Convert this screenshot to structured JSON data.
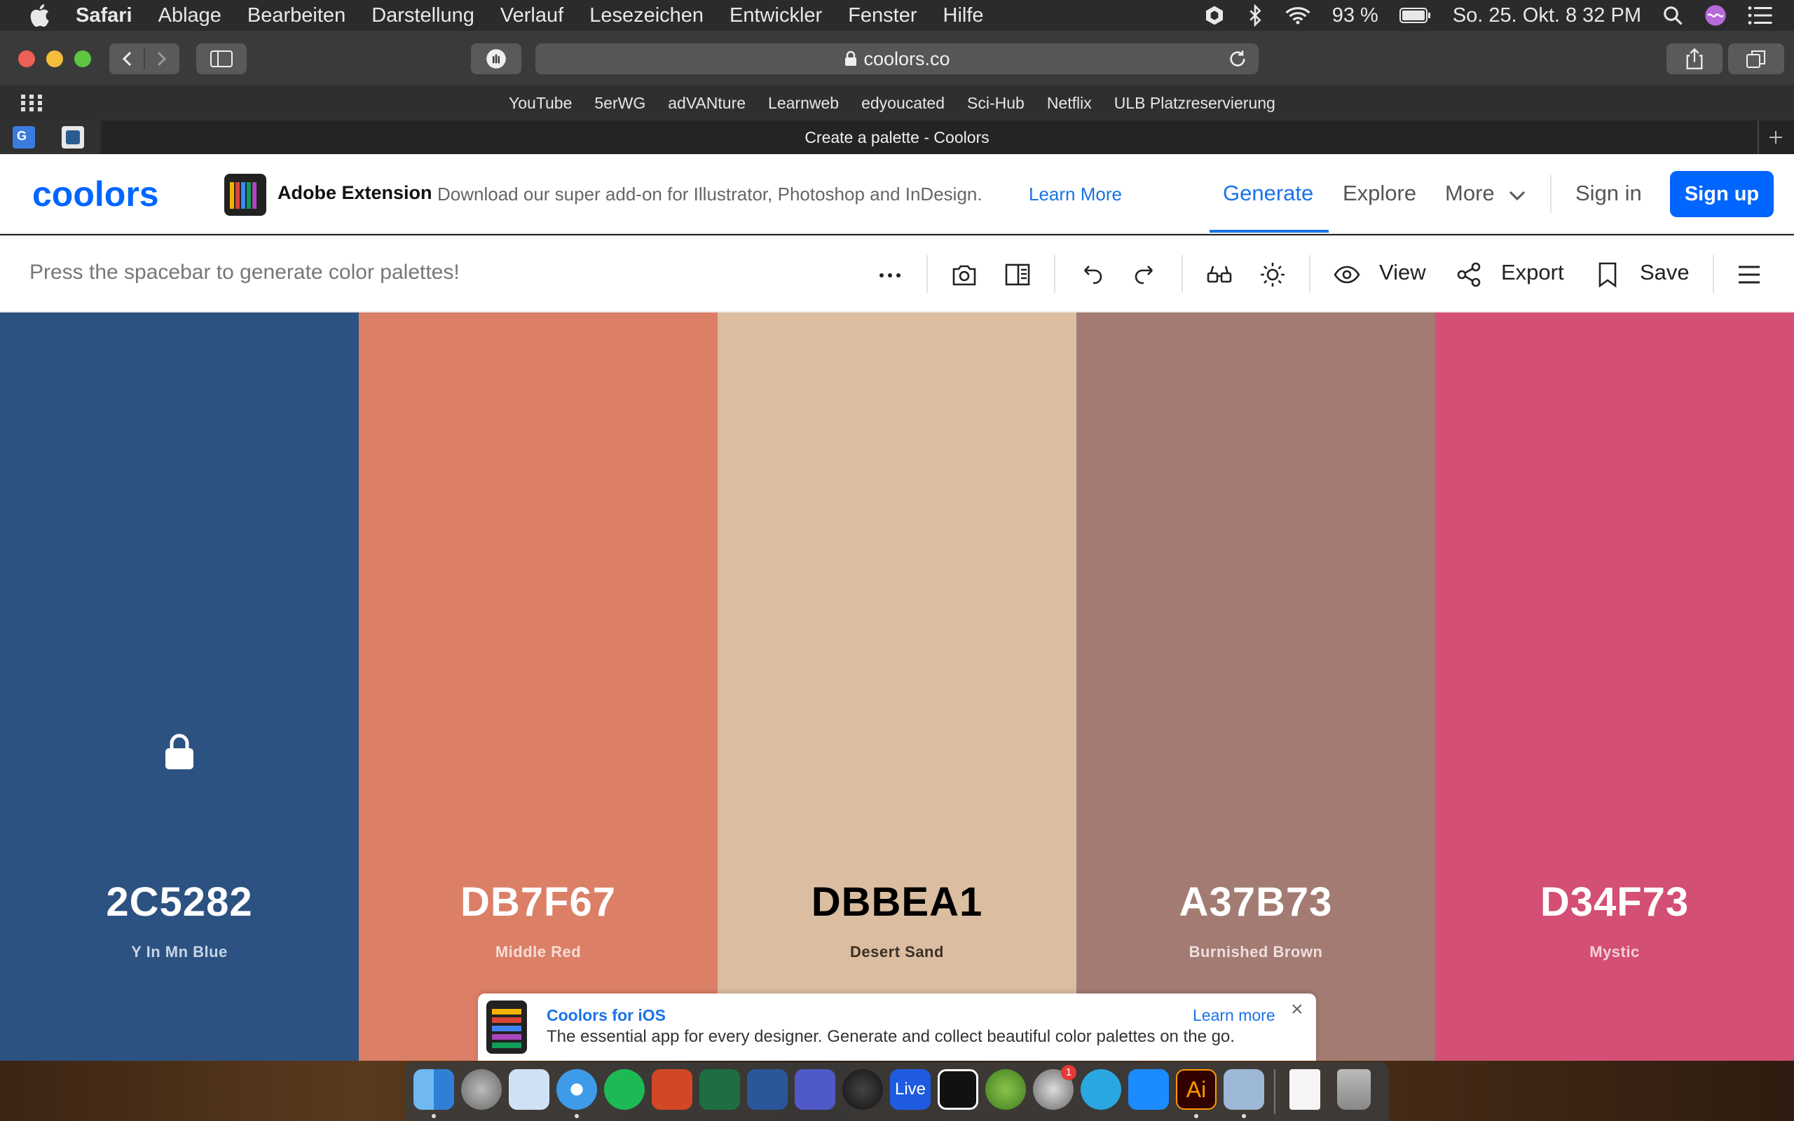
{
  "menubar": {
    "items": [
      "Safari",
      "Ablage",
      "Bearbeiten",
      "Darstellung",
      "Verlauf",
      "Lesezeichen",
      "Entwickler",
      "Fenster",
      "Hilfe"
    ],
    "battery": "93 %",
    "datetime": "So. 25. Okt.  8 32 PM"
  },
  "browser": {
    "url": "coolors.co",
    "bookmarks": [
      "YouTube",
      "5erWG",
      "adVANture",
      "Learnweb",
      "edyoucated",
      "Sci-Hub",
      "Netflix",
      "ULB Platzreservierung"
    ],
    "tab_title": "Create a palette - Coolors"
  },
  "header": {
    "logo": "coolors",
    "ext_title": "Adobe Extension",
    "ext_desc": "Download our super add-on for Illustrator, Photoshop and InDesign.",
    "ext_learn": "Learn More",
    "nav": {
      "generate": "Generate",
      "explore": "Explore",
      "more": "More"
    },
    "signin": "Sign in",
    "signup": "Sign up",
    "accent": "#0066ff"
  },
  "toolbar": {
    "hint": "Press the spacebar to generate color palettes!",
    "view": "View",
    "export": "Export",
    "save": "Save"
  },
  "palette": [
    {
      "hex": "2C5282",
      "name": "Y In Mn Blue",
      "color": "#2C5282",
      "text": "#ffffff",
      "sub": "#c8d4e6",
      "locked": true
    },
    {
      "hex": "DB7F67",
      "name": "Middle Red",
      "color": "#DB7F67",
      "text": "#ffffff",
      "sub": "#f6ddd6",
      "locked": false
    },
    {
      "hex": "DBBEA1",
      "name": "Desert Sand",
      "color": "#DBBEA1",
      "text": "#000000",
      "sub": "#3a3026",
      "locked": false
    },
    {
      "hex": "A37B73",
      "name": "Burnished Brown",
      "color": "#A37B73",
      "text": "#ffffff",
      "sub": "#eedfdc",
      "locked": false
    },
    {
      "hex": "D34F73",
      "name": "Mystic",
      "color": "#D34F73",
      "text": "#ffffff",
      "sub": "#f5d1db",
      "locked": false
    }
  ],
  "banner": {
    "title": "Coolors for iOS",
    "desc": "The essential app for every designer. Generate and collect beautiful color palettes on the go.",
    "learn": "Learn more",
    "close": "×"
  },
  "dock": {
    "apps": [
      "finder",
      "launchpad",
      "preview",
      "safari",
      "spotify",
      "powerpoint",
      "excel",
      "word",
      "teams",
      "gpg",
      "live",
      "intellij",
      "android-studio",
      "system-preferences",
      "cloud",
      "app-store",
      "illustrator",
      "image-capture",
      "document",
      "trash"
    ],
    "prefs_badge": "1",
    "live_label": "Live",
    "ai_label": "Ai"
  }
}
